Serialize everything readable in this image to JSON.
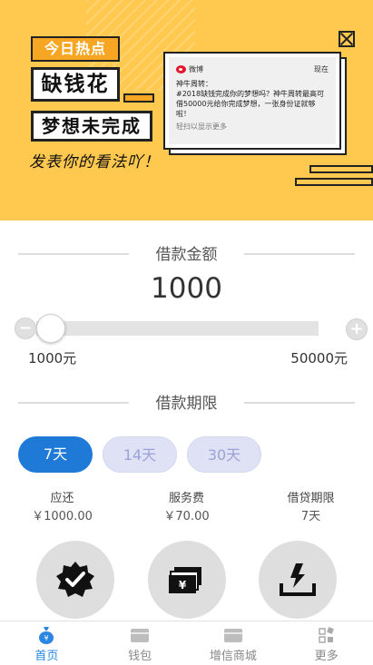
{
  "banner": {
    "tag_hot": "今日热点",
    "tag_big": "缺钱花",
    "tag_mid": "梦想未完成",
    "slogan": "发表你的看法吖！",
    "card": {
      "source": "微博",
      "time": "现在",
      "title": "神牛周转：",
      "body": "#2018缺钱完成你的梦想吗？神牛周转最高可借50000元给你完成梦想，一张身份证就够啦！",
      "footer": "轻扫以显示更多"
    }
  },
  "loan_amount": {
    "title": "借款金额",
    "value": "1000",
    "min_label": "1000元",
    "max_label": "50000元",
    "minus_symbol": "−",
    "plus_symbol": "+",
    "slider_fraction": 0
  },
  "loan_period": {
    "title": "借款期限",
    "options": [
      {
        "label": "7天",
        "selected": true
      },
      {
        "label": "14天",
        "selected": false
      },
      {
        "label": "30天",
        "selected": false
      }
    ]
  },
  "summary": [
    {
      "label": "应还",
      "value": "￥1000.00"
    },
    {
      "label": "服务费",
      "value": "￥70.00"
    },
    {
      "label": "借贷期限",
      "value": "7天"
    }
  ],
  "actions": [
    {
      "icon": "verified-badge-icon"
    },
    {
      "icon": "cash-icon"
    },
    {
      "icon": "withdraw-icon"
    }
  ],
  "nav": {
    "items": [
      {
        "label": "首页",
        "icon": "money-bag-icon",
        "active": true
      },
      {
        "label": "钱包",
        "icon": "wallet-icon",
        "active": false
      },
      {
        "label": "增信商城",
        "icon": "shop-icon",
        "active": false
      },
      {
        "label": "更多",
        "icon": "more-grid-icon",
        "active": false
      }
    ]
  },
  "colors": {
    "banner_bg": "#ffc84e",
    "accent": "#1e7ad6",
    "pill_inactive": "#dfe2f5"
  }
}
